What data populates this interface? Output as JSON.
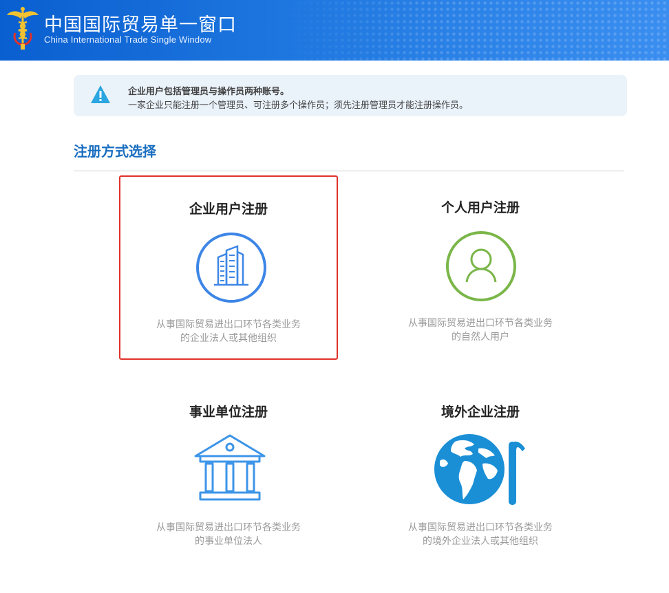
{
  "header": {
    "title_cn": "中国国际贸易单一窗口",
    "title_en": "China International Trade Single  Window"
  },
  "notice": {
    "line1": "企业用户包括管理员与操作员两种账号。",
    "line2": "一家企业只能注册一个管理员、可注册多个操作员；须先注册管理员才能注册操作员。"
  },
  "section": {
    "title": "注册方式选择"
  },
  "cards": [
    {
      "title": "企业用户注册",
      "icon": "building-icon",
      "desc1": "从事国际贸易进出口环节各类业务",
      "desc2": "的企业法人或其他组织",
      "selected": true
    },
    {
      "title": "个人用户注册",
      "icon": "person-icon",
      "desc1": "从事国际贸易进出口环节各类业务",
      "desc2": "的自然人用户",
      "selected": false
    },
    {
      "title": "事业单位注册",
      "icon": "institution-icon",
      "desc1": "从事国际贸易进出口环节各类业务",
      "desc2": "的事业单位法人",
      "selected": false
    },
    {
      "title": "境外企业注册",
      "icon": "globe-icon",
      "desc1": "从事国际贸易进出口环节各类业务",
      "desc2": "的境外企业法人或其他组织",
      "selected": false
    }
  ],
  "colors": {
    "header_blue": "#1f78e0",
    "accent_blue": "#1b6fc0",
    "building_blue": "#3d86e6",
    "person_green": "#7ab648",
    "institution_blue": "#3d95e8",
    "globe_blue": "#1a8fd6",
    "selected_red": "#e0312a",
    "warning_blue": "#2aa6e0"
  }
}
